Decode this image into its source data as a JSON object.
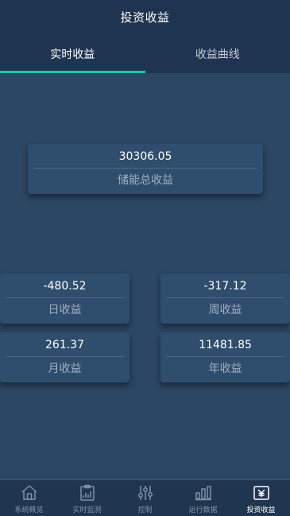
{
  "header": {
    "title": "投资收益"
  },
  "tabs": [
    {
      "label": "实时收益",
      "active": true
    },
    {
      "label": "收益曲线",
      "active": false
    }
  ],
  "cards": {
    "total": {
      "value": "30306.05",
      "label": "储能总收益"
    },
    "day": {
      "value": "-480.52",
      "label": "日收益"
    },
    "week": {
      "value": "-317.12",
      "label": "周收益"
    },
    "month": {
      "value": "261.37",
      "label": "月收益"
    },
    "year": {
      "value": "11481.85",
      "label": "年收益"
    }
  },
  "bottom_nav": [
    {
      "label": "系统概览",
      "icon": "home-icon",
      "active": false
    },
    {
      "label": "实时监测",
      "icon": "monitor-icon",
      "active": false
    },
    {
      "label": "控制",
      "icon": "sliders-icon",
      "active": false
    },
    {
      "label": "运行数据",
      "icon": "bar-chart-icon",
      "active": false
    },
    {
      "label": "投资收益",
      "icon": "yuan-icon",
      "active": true
    }
  ],
  "colors": {
    "background": "#2c4764",
    "header": "#1f3451",
    "tab_indicator": "#1ec6a4",
    "card": "#2f4d6d"
  }
}
